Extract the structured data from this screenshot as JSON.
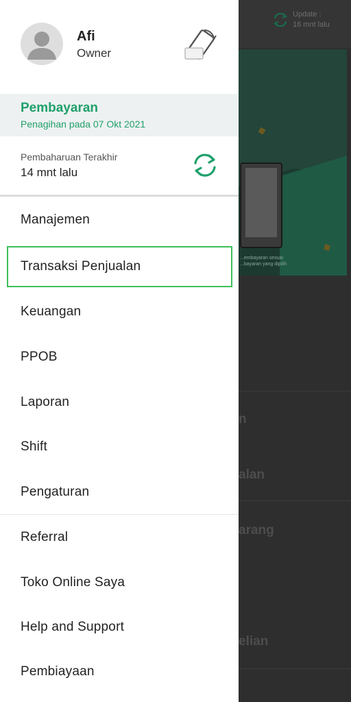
{
  "background": {
    "update_label_1": "Update :",
    "update_label_2": "16 mnt lalu",
    "banner_text_1": "...embayaran sesuai",
    "banner_text_2": "...bayaran yang dipilih",
    "partial_items": [
      "n",
      "alan",
      "arang",
      "elian"
    ]
  },
  "profile": {
    "name": "Afi",
    "role": "Owner",
    "avatar_icon": "avatar-placeholder-icon",
    "rotate_icon": "screen-rotate-icon"
  },
  "payment": {
    "title": "Pembayaran",
    "subtitle": "Penagihan pada 07 Okt 2021"
  },
  "last_update": {
    "label": "Pembaharuan Terakhir",
    "value": "14 mnt lalu",
    "icon": "refresh-icon"
  },
  "menu": {
    "items": [
      {
        "label": "Manajemen"
      },
      {
        "label": "Transaksi Penjualan"
      },
      {
        "label": "Keuangan"
      },
      {
        "label": "PPOB"
      },
      {
        "label": "Laporan"
      },
      {
        "label": "Shift"
      },
      {
        "label": "Pengaturan"
      },
      {
        "label": "Referral"
      },
      {
        "label": "Toko Online Saya"
      },
      {
        "label": "Help and Support"
      },
      {
        "label": "Pembiayaan"
      }
    ]
  },
  "colors": {
    "accent": "#1fa06b",
    "highlight_border": "#3cbf5a"
  }
}
